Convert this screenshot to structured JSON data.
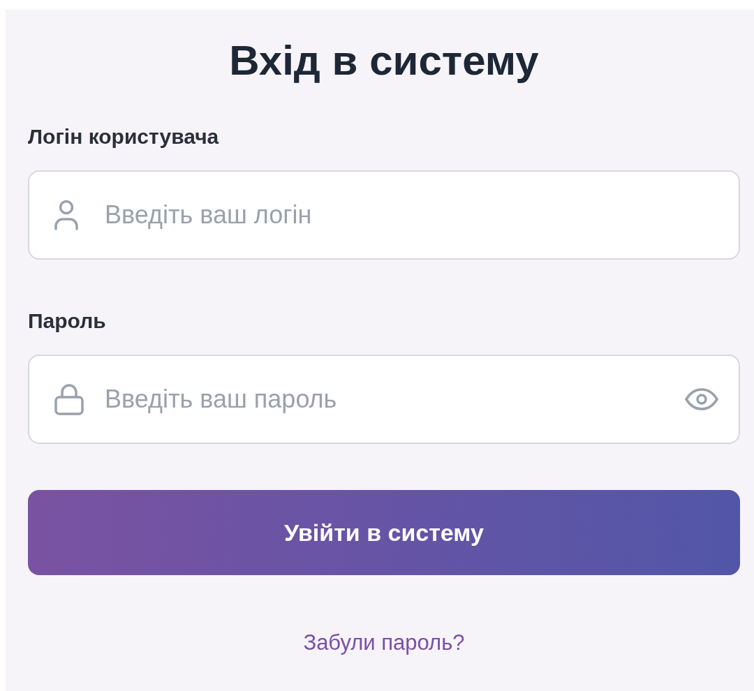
{
  "title": "Вхід в систему",
  "fields": [
    {
      "label": "Логін користувача",
      "kind": "user",
      "placeholder": "Введіть ваш логін",
      "password_toggle": false
    },
    {
      "label": "Пароль",
      "kind": "lock",
      "placeholder": "Введіть ваш пароль",
      "password_toggle": true
    }
  ],
  "submit_button": "Увійти в систему",
  "forgot_link": "Забули пароль?"
}
